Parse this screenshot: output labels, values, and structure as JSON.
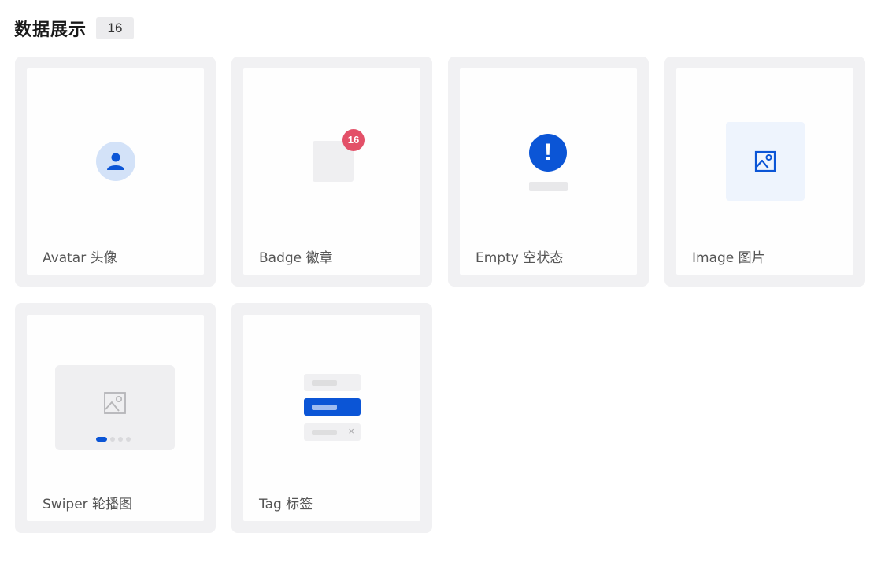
{
  "section": {
    "title": "数据展示",
    "count": "16"
  },
  "cards": [
    {
      "label": "Avatar 头像",
      "icon": "avatar-person-icon"
    },
    {
      "label": "Badge 徽章",
      "icon": "badge-icon",
      "badge_value": "16"
    },
    {
      "label": "Empty 空状态",
      "icon": "exclamation-icon",
      "glyph": "!"
    },
    {
      "label": "Image 图片",
      "icon": "image-icon"
    },
    {
      "label": "Swiper 轮播图",
      "icon": "image-icon"
    },
    {
      "label": "Tag 标签",
      "icon": "tag-icon",
      "close_glyph": "×"
    }
  ],
  "colors": {
    "accent": "#0b55d6",
    "badge": "#e35068",
    "card_bg": "#f1f1f3",
    "avatar_bg": "#d3e2f8",
    "image_bg": "#eef4fd"
  }
}
